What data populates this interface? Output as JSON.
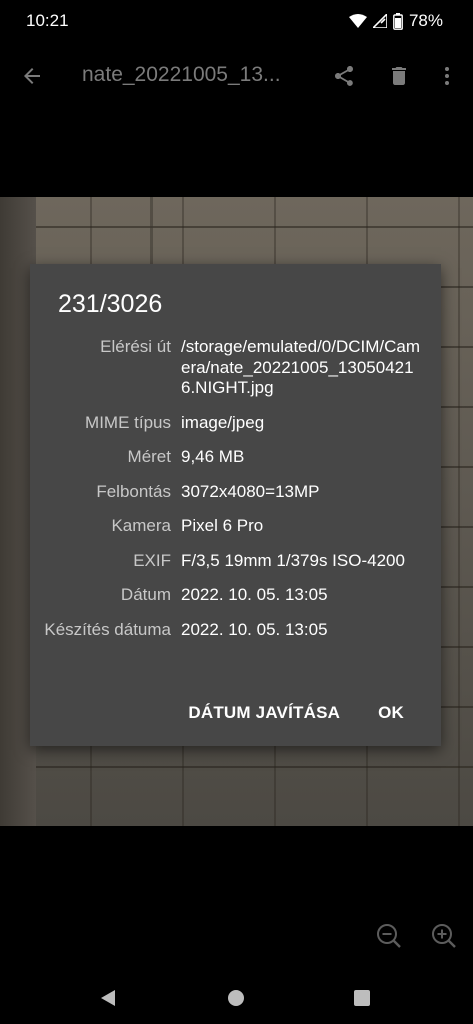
{
  "status_bar": {
    "time": "10:21",
    "battery": "78%",
    "icons": [
      "wifi-icon",
      "signal-icon",
      "battery-icon"
    ]
  },
  "toolbar": {
    "title": "nate_20221005_13...",
    "icons": [
      "back-arrow-icon",
      "share-icon",
      "trash-icon",
      "more-vert-icon"
    ]
  },
  "dialog": {
    "title": "231/3026",
    "rows": [
      {
        "label": "Elérési út",
        "value": "/storage/emulated/0/DCIM/Camera/nate_20221005_130504216.NIGHT.jpg"
      },
      {
        "label": "MIME típus",
        "value": "image/jpeg"
      },
      {
        "label": "Méret",
        "value": "9,46 MB"
      },
      {
        "label": "Felbontás",
        "value": "3072x4080=13MP"
      },
      {
        "label": "Kamera",
        "value": "Pixel 6 Pro"
      },
      {
        "label": "EXIF",
        "value": "F/3,5 19mm 1/379s ISO-4200"
      },
      {
        "label": "Dátum",
        "value": "2022. 10. 05. 13:05"
      },
      {
        "label": "Készítés dátuma",
        "value": "2022. 10. 05. 13:05"
      }
    ],
    "buttons": {
      "fix_date": "DÁTUM JAVÍTÁSA",
      "ok": "OK"
    }
  },
  "zoom": {
    "icons": [
      "zoom-out-icon",
      "zoom-in-icon"
    ]
  },
  "nav": {
    "icons": [
      "nav-back-icon",
      "nav-home-icon",
      "nav-recents-icon"
    ]
  }
}
